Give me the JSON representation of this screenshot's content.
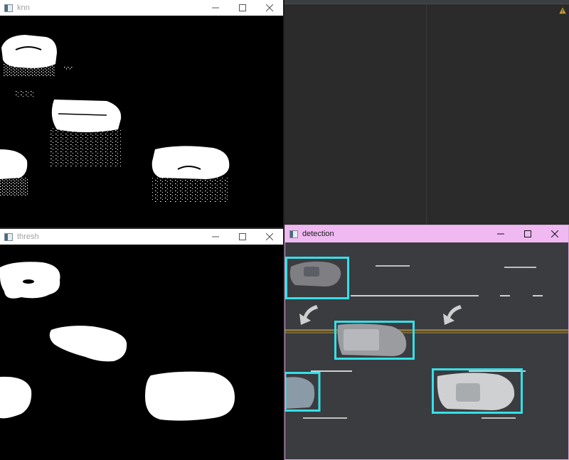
{
  "windows": {
    "knn": {
      "title": "knn"
    },
    "thresh": {
      "title": "thresh"
    },
    "detection": {
      "title": "detection"
    }
  },
  "colors": {
    "detection_titlebar": "#f0b9f2",
    "bounding_box": "#35e0e8",
    "editor_bg": "#2b2b2b"
  },
  "icons": {
    "minimize": "minimize-icon",
    "maximize": "maximize-icon",
    "close": "close-icon",
    "warning": "warning-icon"
  }
}
